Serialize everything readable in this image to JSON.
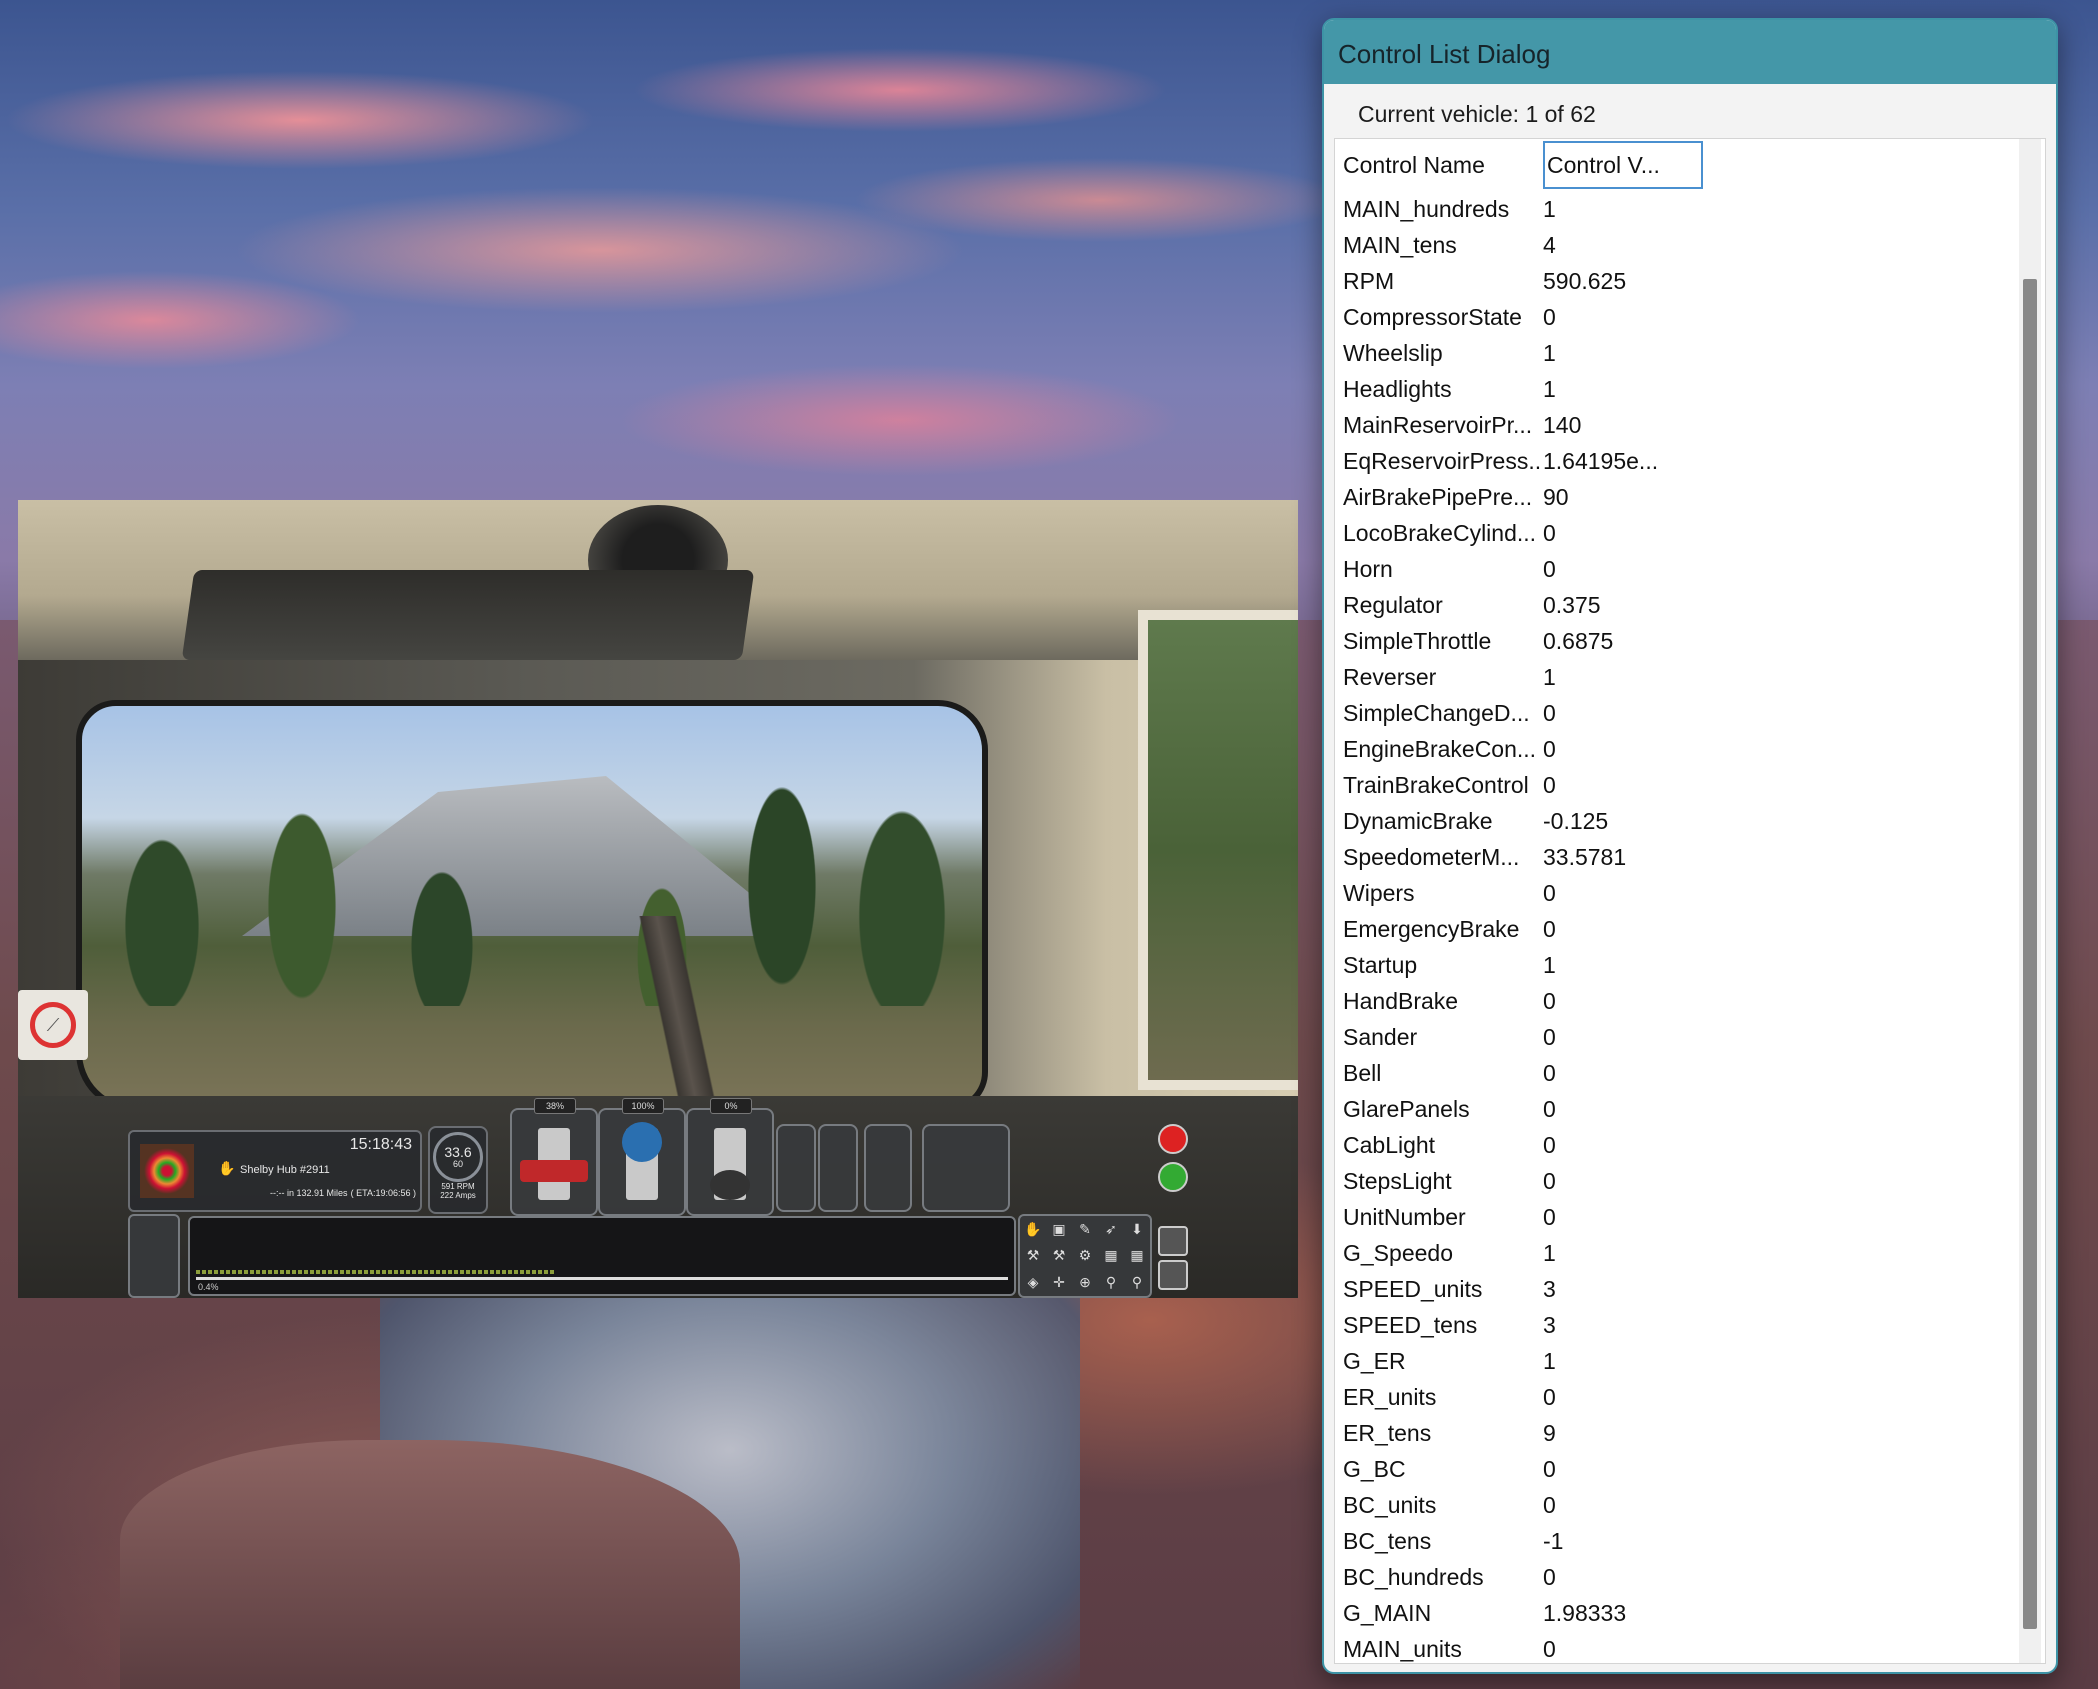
{
  "dialog": {
    "title": "Control List Dialog",
    "current_vehicle": "Current vehicle: 1 of 62",
    "header": {
      "name": "Control Name",
      "value": "Control V..."
    },
    "rows": [
      {
        "name": "MAIN_hundreds",
        "value": "1"
      },
      {
        "name": "MAIN_tens",
        "value": "4"
      },
      {
        "name": "RPM",
        "value": "590.625"
      },
      {
        "name": "CompressorState",
        "value": "0"
      },
      {
        "name": "Wheelslip",
        "value": "1"
      },
      {
        "name": "Headlights",
        "value": "1"
      },
      {
        "name": "MainReservoirPr...",
        "value": "140"
      },
      {
        "name": "EqReservoirPress...",
        "value": "1.64195e..."
      },
      {
        "name": "AirBrakePipePre...",
        "value": "90"
      },
      {
        "name": "LocoBrakeCylind...",
        "value": "0"
      },
      {
        "name": "Horn",
        "value": "0"
      },
      {
        "name": "Regulator",
        "value": "0.375"
      },
      {
        "name": "SimpleThrottle",
        "value": "0.6875"
      },
      {
        "name": "Reverser",
        "value": "1"
      },
      {
        "name": "SimpleChangeD...",
        "value": "0"
      },
      {
        "name": "EngineBrakeCon...",
        "value": "0"
      },
      {
        "name": "TrainBrakeControl",
        "value": "0"
      },
      {
        "name": "DynamicBrake",
        "value": "-0.125"
      },
      {
        "name": "SpeedometerM...",
        "value": "33.5781"
      },
      {
        "name": "Wipers",
        "value": "0"
      },
      {
        "name": "EmergencyBrake",
        "value": "0"
      },
      {
        "name": "Startup",
        "value": "1"
      },
      {
        "name": "HandBrake",
        "value": "0"
      },
      {
        "name": "Sander",
        "value": "0"
      },
      {
        "name": "Bell",
        "value": "0"
      },
      {
        "name": "GlarePanels",
        "value": "0"
      },
      {
        "name": "CabLight",
        "value": "0"
      },
      {
        "name": "StepsLight",
        "value": "0"
      },
      {
        "name": "UnitNumber",
        "value": "0"
      },
      {
        "name": "G_Speedo",
        "value": "1"
      },
      {
        "name": "SPEED_units",
        "value": "3"
      },
      {
        "name": "SPEED_tens",
        "value": "3"
      },
      {
        "name": "G_ER",
        "value": "1"
      },
      {
        "name": "ER_units",
        "value": "0"
      },
      {
        "name": "ER_tens",
        "value": "9"
      },
      {
        "name": "G_BC",
        "value": "0"
      },
      {
        "name": "BC_units",
        "value": "0"
      },
      {
        "name": "BC_tens",
        "value": "-1"
      },
      {
        "name": "BC_hundreds",
        "value": "0"
      },
      {
        "name": "G_MAIN",
        "value": "1.98333"
      },
      {
        "name": "MAIN_units",
        "value": "0"
      }
    ]
  },
  "game_hud": {
    "time": "15:18:43",
    "destination": "Shelby Hub #2911",
    "distance_prefix": "--:--",
    "distance": "in  132.91 Miles",
    "eta": "( ETA:19:06:56 )",
    "speed": "33.6",
    "speed_limit": "60",
    "rpm": "591 RPM",
    "amps": "222 Amps",
    "throttle_pct": "38%",
    "reverser_pct": "100%",
    "brake_pct": "0%",
    "grade": "0.4%"
  },
  "colors": {
    "dialog_titlebar": "#4497a8",
    "header_focus": "#4a90d0",
    "throttle_handle": "#c0282a",
    "reverser_handle": "#2a6fb0"
  },
  "icons": {
    "hand": "hand-icon",
    "no_smoking": "no-smoking-icon",
    "emergency": "red-alarm-icon",
    "go": "green-key-icon",
    "pause": "pause-icon",
    "camera": "camera-icon"
  }
}
